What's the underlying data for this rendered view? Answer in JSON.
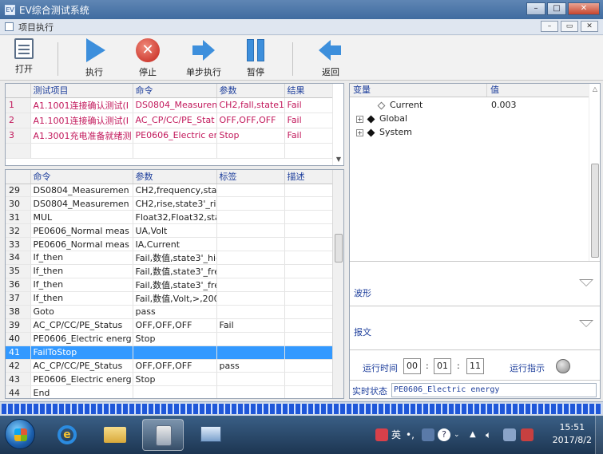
{
  "window": {
    "title": "EV综合测试系统",
    "minimize": "–",
    "maximize": "□",
    "close": "✕"
  },
  "subwindow": {
    "title": "项目执行"
  },
  "toolbar": {
    "open": "打开",
    "run": "执行",
    "stop": "停止",
    "step": "单步执行",
    "pause": "暂停",
    "back": "返回"
  },
  "test_items": {
    "headers": [
      "测试项目",
      "命令",
      "参数",
      "结果"
    ],
    "rows": [
      {
        "num": "1",
        "item": "A1.1001连接确认测试(Ⅰ",
        "cmd": "DS0804_Measuremen",
        "param": "CH2,fall,state1_",
        "result": "Fail"
      },
      {
        "num": "2",
        "item": "A1.1001连接确认测试(Ⅰ",
        "cmd": "AC_CP/CC/PE_Stat",
        "param": "OFF,OFF,OFF",
        "result": "Fail"
      },
      {
        "num": "3",
        "item": "A1.3001充电准备就绪测",
        "cmd": "PE0606_Electric en",
        "param": "Stop",
        "result": "Fail"
      }
    ]
  },
  "steps": {
    "headers": [
      "命令",
      "参数",
      "标签",
      "描述"
    ],
    "rows": [
      {
        "num": "29",
        "cmd": "DS0804_Measuremen",
        "param": "CH2,frequency,sta",
        "tag": ""
      },
      {
        "num": "30",
        "cmd": "DS0804_Measuremen",
        "param": "CH2,rise,state3'_ris",
        "tag": ""
      },
      {
        "num": "31",
        "cmd": "MUL",
        "param": "Float32,Float32,sta",
        "tag": ""
      },
      {
        "num": "32",
        "cmd": "PE0606_Normal meas",
        "param": "UA,Volt",
        "tag": ""
      },
      {
        "num": "33",
        "cmd": "PE0606_Normal meas",
        "param": "IA,Current",
        "tag": ""
      },
      {
        "num": "34",
        "cmd": "If_then",
        "param": "Fail,数值,state3'_hig",
        "tag": ""
      },
      {
        "num": "35",
        "cmd": "If_then",
        "param": "Fail,数值,state3'_fre",
        "tag": ""
      },
      {
        "num": "36",
        "cmd": "If_then",
        "param": "Fail,数值,state3'_fre",
        "tag": ""
      },
      {
        "num": "37",
        "cmd": "If_then",
        "param": "Fail,数值,Volt,>,200",
        "tag": ""
      },
      {
        "num": "38",
        "cmd": "Goto",
        "param": "pass",
        "tag": ""
      },
      {
        "num": "39",
        "cmd": "AC_CP/CC/PE_Status",
        "param": "OFF,OFF,OFF",
        "tag": "Fail"
      },
      {
        "num": "40",
        "cmd": "PE0606_Electric energ",
        "param": "Stop",
        "tag": ""
      },
      {
        "num": "41",
        "cmd": "FailToStop",
        "param": "",
        "tag": "",
        "selected": true
      },
      {
        "num": "42",
        "cmd": "AC_CP/CC/PE_Status",
        "param": "OFF,OFF,OFF",
        "tag": "pass"
      },
      {
        "num": "43",
        "cmd": "PE0606_Electric energ",
        "param": "Stop",
        "tag": ""
      },
      {
        "num": "44",
        "cmd": "End",
        "param": "",
        "tag": ""
      }
    ]
  },
  "variables": {
    "headers": [
      "变量",
      "值"
    ],
    "current": {
      "name": "Current",
      "value": "0.003"
    },
    "global": "Global",
    "system": "System"
  },
  "sections": {
    "waveform": "波形",
    "message": "报文"
  },
  "runtime": {
    "label": "运行时间",
    "hh": "00",
    "mm": "01",
    "ss": "11",
    "indicator_label": "运行指示"
  },
  "status": {
    "label": "实时状态",
    "text": "PE0606_Electric energy"
  },
  "progress": {
    "value": 1.0
  },
  "taskbar": {
    "ime": "英",
    "time": "15:51",
    "date": "2017/8/2"
  },
  "colors": {
    "accent": "#3d8fdc",
    "fail_text": "#c2185b",
    "header_text": "#1e3f9c",
    "selection": "#3399ff"
  }
}
